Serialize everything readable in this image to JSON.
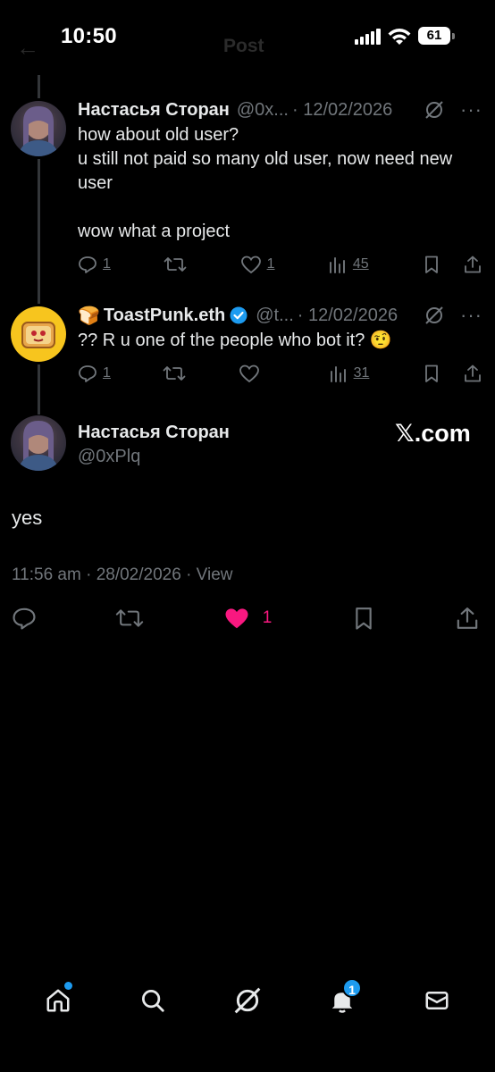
{
  "status_bar": {
    "time": "10:50",
    "battery": "61"
  },
  "header": {
    "title": "Post"
  },
  "tweets": [
    {
      "name": "Настасья Сторан",
      "handle": "@0x...",
      "date": "· 12/02/2026",
      "body": "how about old user?\nu still not paid so many old user, now need new user\n\nwow what a project",
      "replies": "1",
      "retweets": "",
      "likes": "1",
      "views": "45"
    },
    {
      "name_prefix": "🍞",
      "name": "ToastPunk.eth",
      "handle": "@t...",
      "date": "· 12/02/2026",
      "body": "?? R u one of the people who bot it? 🤨",
      "replies": "1",
      "retweets": "",
      "likes": "",
      "views": "31"
    }
  ],
  "main_tweet": {
    "name": "Настасья Сторан",
    "handle": "@0xPlq",
    "watermark": "𝕏.com",
    "text": "yes",
    "meta": "11:56 am · 28/02/2026 · View",
    "likes": "1"
  },
  "bottom_nav": {
    "notifications_badge": "1"
  },
  "colors": {
    "background": "#000000",
    "accent": "#1d9bf0",
    "like": "#f91880",
    "muted": "#71767b"
  }
}
